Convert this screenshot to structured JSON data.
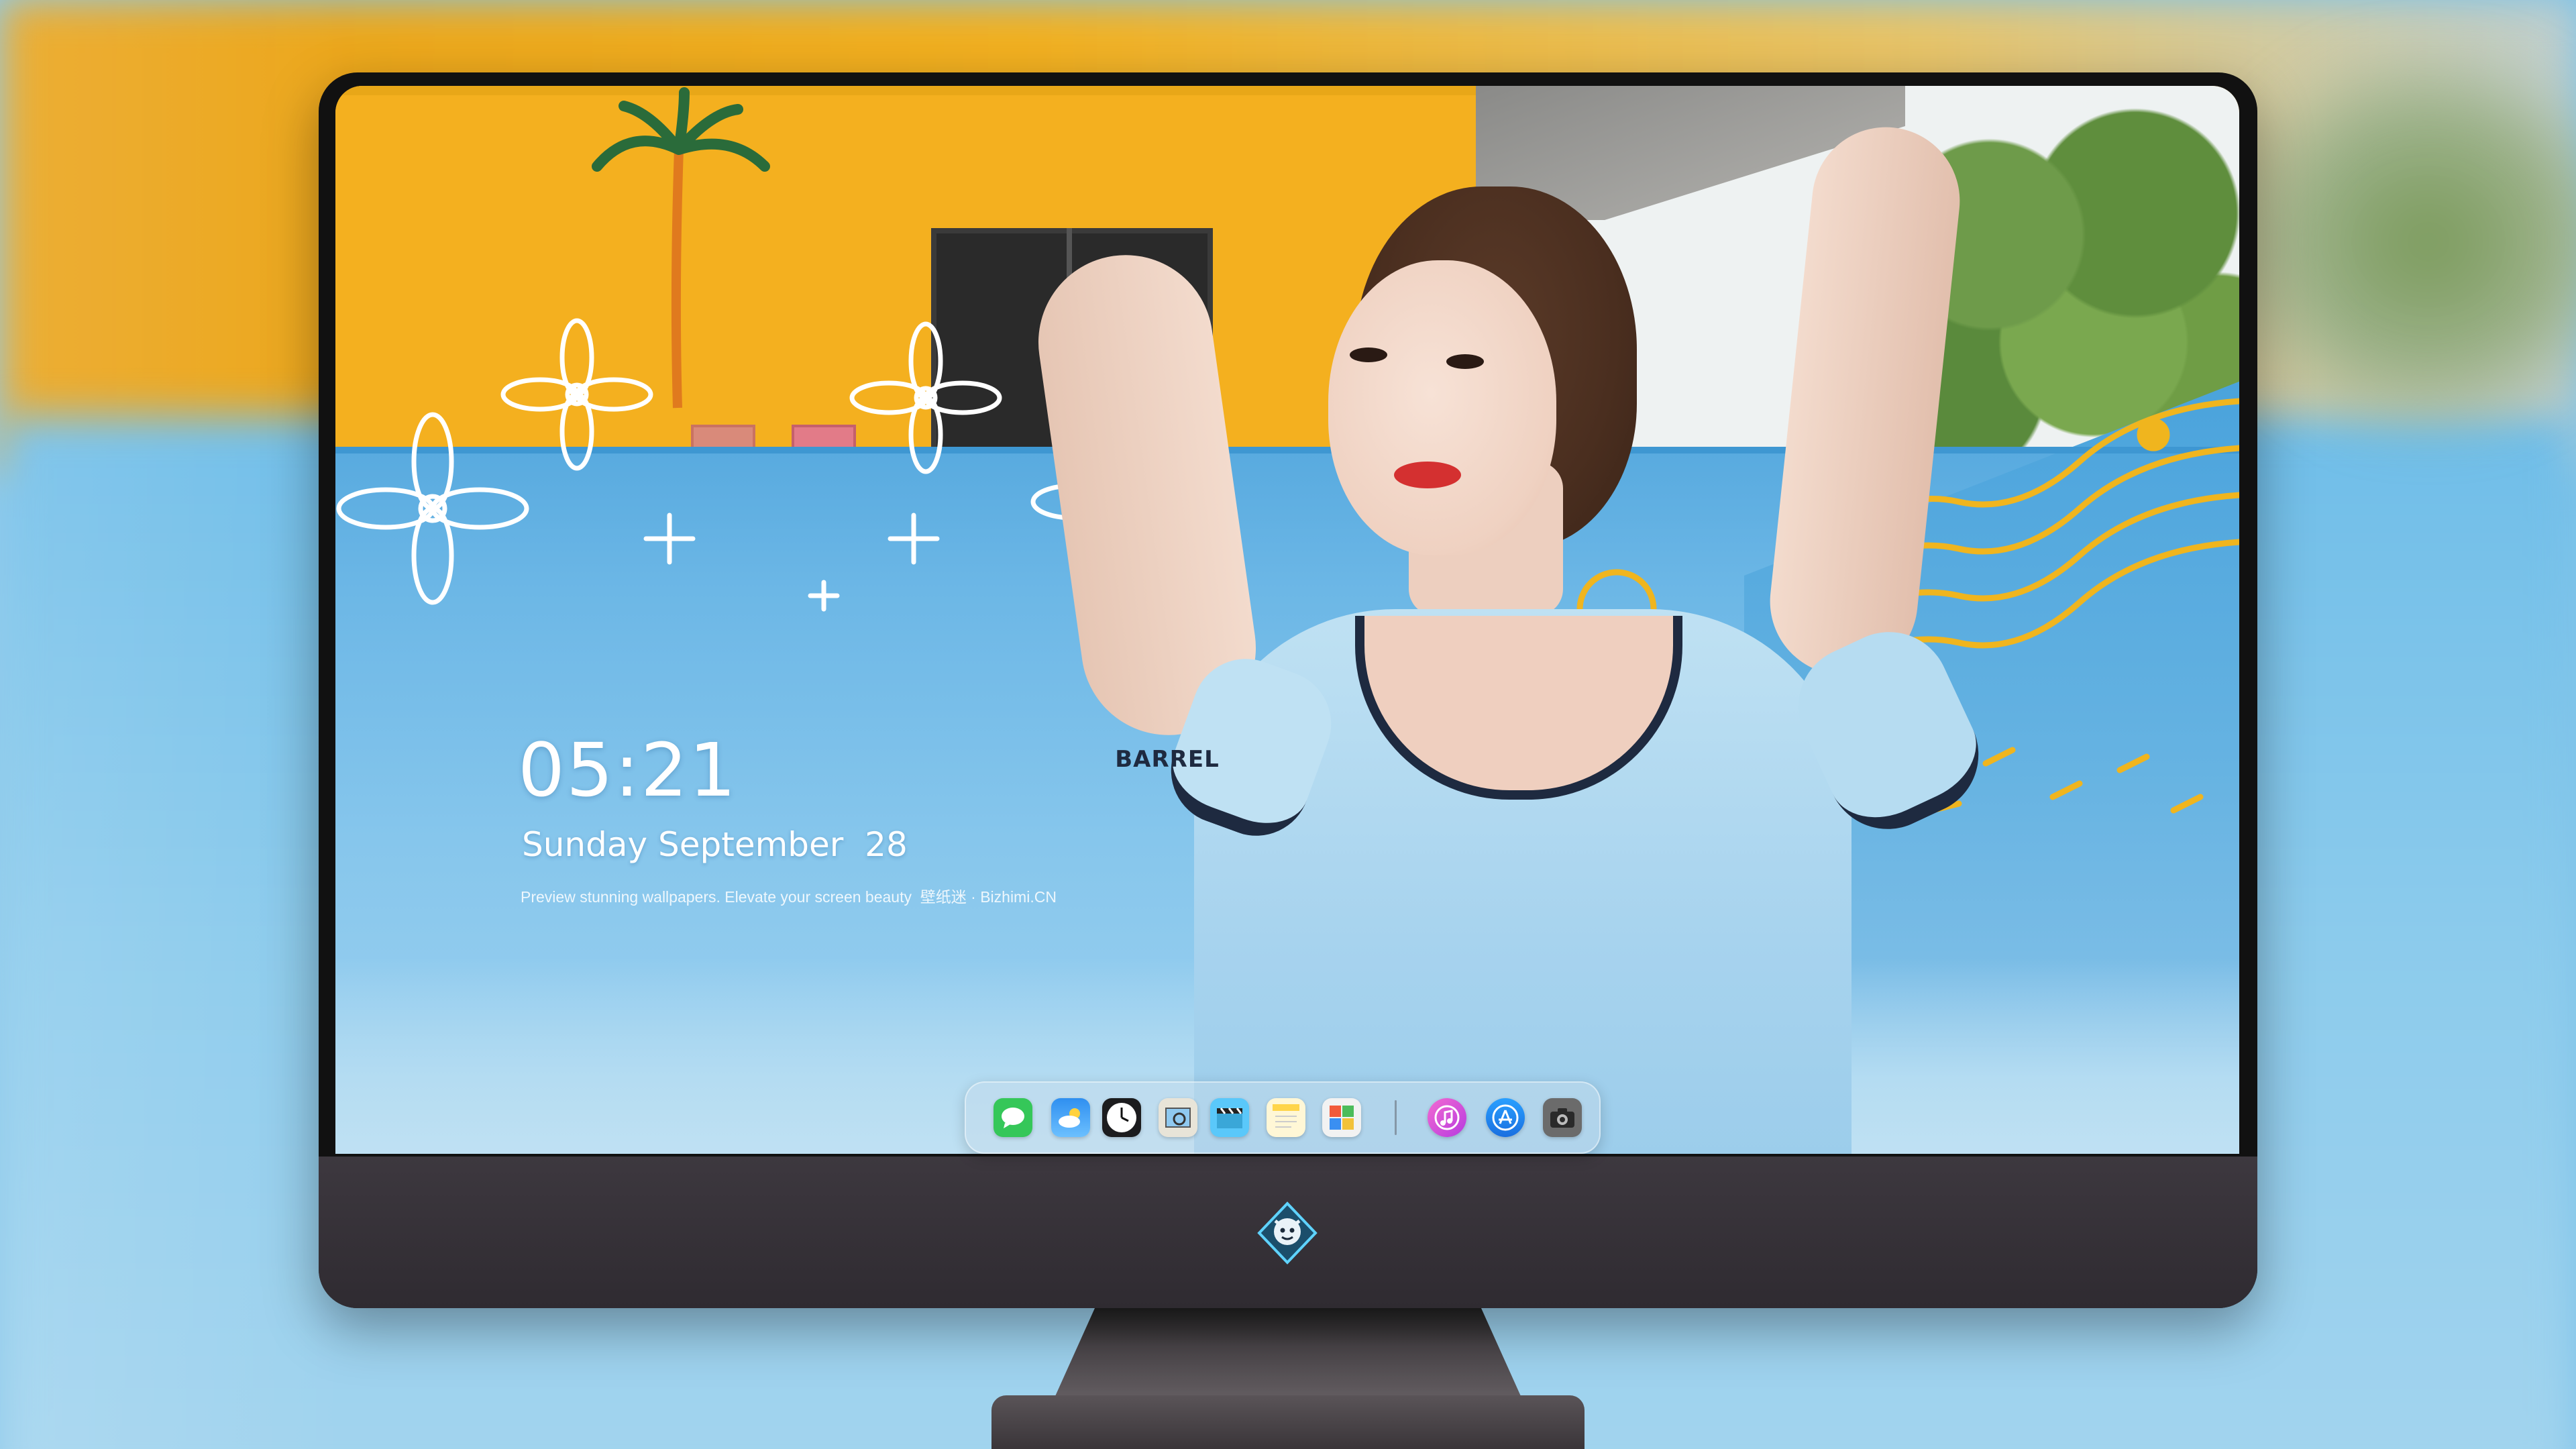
{
  "clock": {
    "time": "05:21",
    "date": "Sunday September  28",
    "tagline": "Preview stunning wallpapers. Elevate your screen beauty  壁纸迷 · Bizhimi.CN"
  },
  "shirt": {
    "brand": "BARREL"
  },
  "dock": {
    "apps": [
      {
        "name": "Messages",
        "icon": "message-bubble-icon",
        "color": "#35c759"
      },
      {
        "name": "Weather",
        "icon": "weather-cloud-sun-icon",
        "color": "#2f8ff0"
      },
      {
        "name": "Clock",
        "icon": "clock-icon",
        "color": "#1c1c1e"
      },
      {
        "name": "Preview",
        "icon": "preview-photo-icon",
        "color": "#e8e4d8"
      },
      {
        "name": "Clips",
        "icon": "clapperboard-icon",
        "color": "#5ac8fa"
      },
      {
        "name": "Notes",
        "icon": "notes-icon",
        "color": "#ffd54a"
      },
      {
        "name": "Photo Booth",
        "icon": "photo-booth-icon",
        "color": "#f2f2f2"
      },
      {
        "name": "iTunes",
        "icon": "music-note-icon",
        "color": "#e04bd6"
      },
      {
        "name": "App Store",
        "icon": "app-store-icon",
        "color": "#1e90ff"
      },
      {
        "name": "Screenshot",
        "icon": "camera-icon",
        "color": "#6b6b6b"
      }
    ]
  }
}
